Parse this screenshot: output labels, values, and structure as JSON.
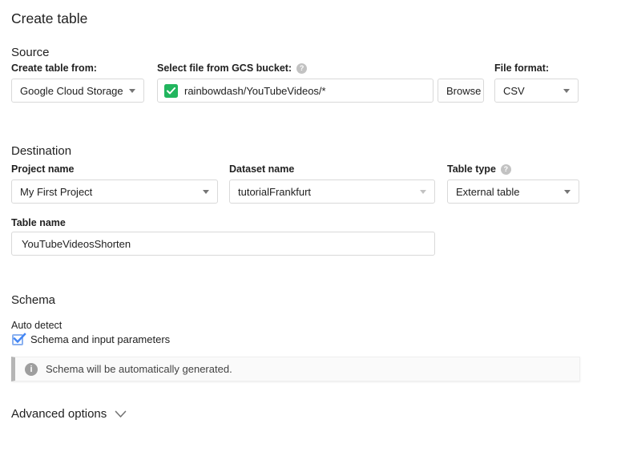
{
  "page": {
    "title": "Create table"
  },
  "source": {
    "heading": "Source",
    "create_table_from": {
      "label": "Create table from:",
      "value": "Google Cloud Storage"
    },
    "gcs_file": {
      "label": "Select file from GCS bucket:",
      "help_icon": "question-mark-circle",
      "valid_icon": "green-check",
      "value": "rainbowdash/YouTubeVideos/*",
      "browse_label": "Browse"
    },
    "file_format": {
      "label": "File format:",
      "value": "CSV"
    }
  },
  "destination": {
    "heading": "Destination",
    "project": {
      "label": "Project name",
      "value": "My First Project"
    },
    "dataset": {
      "label": "Dataset name",
      "value": "tutorialFrankfurt"
    },
    "table_type": {
      "label": "Table type",
      "help_icon": "question-mark-circle",
      "value": "External table"
    },
    "table_name": {
      "label": "Table name",
      "value": "YouTubeVideosShorten"
    }
  },
  "schema": {
    "heading": "Schema",
    "auto_detect_label": "Auto detect",
    "checkbox_label": "Schema and input parameters",
    "checkbox_checked": true,
    "info_icon": "info-circle",
    "info_message": "Schema will be automatically generated."
  },
  "advanced": {
    "label": "Advanced options",
    "expand_icon": "chevron-down"
  },
  "colors": {
    "valid_green": "#22b55e",
    "checkbox_blue": "#4285f4",
    "info_grey": "#9e9e9e",
    "border_grey": "#d9d9d9"
  }
}
